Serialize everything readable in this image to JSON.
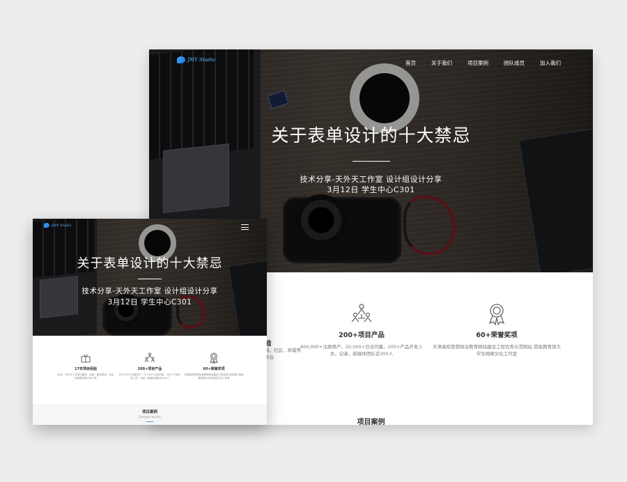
{
  "brand": {
    "logo_text": "JMY Studio",
    "accent": "#3aa6e0"
  },
  "nav": {
    "items": [
      "首页",
      "关于我们",
      "项目案例",
      "团队成员",
      "加入我们"
    ]
  },
  "hero": {
    "title": "关于表单设计的十大禁忌",
    "line1": "技术分享-天外天工作室 设计组设计分享",
    "line2": "3月12日 学生中心C301"
  },
  "features": [
    {
      "icon": "gift-icon",
      "title": "17年项目经验",
      "desc": "一站式、天外天工作室已建设、运维、服务网站、社区、商城等多类平台产品"
    },
    {
      "icon": "team-icon",
      "title": "200+项目产品",
      "desc": "800,000+注册用户，20,000+日访问量，200+产品开发人员、记者，新媒体团队近200人"
    },
    {
      "icon": "award-icon",
      "title": "60+荣誉奖项",
      "desc": "天津高校思想政治教育网站建设工程优秀示范网站 首批教育部大学生网络文化工作室"
    }
  ],
  "large_partial": {
    "title": "验",
    "desc": "网、社区、商城等平台"
  },
  "section": {
    "title": "项目案例",
    "subtitle": "Sample works"
  }
}
